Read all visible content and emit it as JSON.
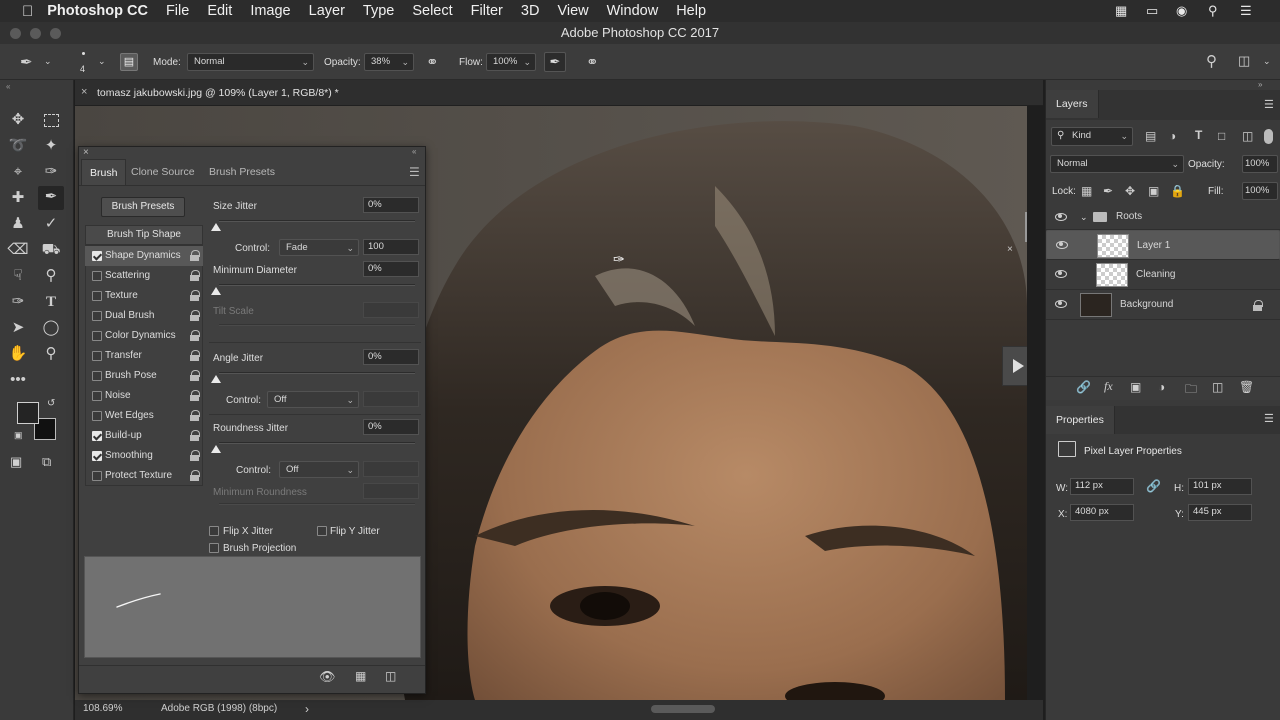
{
  "menubar": {
    "app": "Photoshop CC",
    "items": [
      "File",
      "Edit",
      "Image",
      "Layer",
      "Type",
      "Select",
      "Filter",
      "3D",
      "View",
      "Window",
      "Help"
    ]
  },
  "window": {
    "title": "Adobe Photoshop CC 2017"
  },
  "options": {
    "brush_size": "4",
    "mode_label": "Mode:",
    "mode_value": "Normal",
    "opacity_label": "Opacity:",
    "opacity_value": "38%",
    "flow_label": "Flow:",
    "flow_value": "100%"
  },
  "document": {
    "tab_title": "tomasz jakubowski.jpg @ 109% (Layer 1, RGB/8*) *"
  },
  "status": {
    "zoom": "108.69%",
    "profile": "Adobe RGB (1998) (8bpc)"
  },
  "brush_panel": {
    "tabs": [
      "Brush",
      "Clone Source",
      "Brush Presets"
    ],
    "presets_button": "Brush Presets",
    "tip_shape": "Brush Tip Shape",
    "options": [
      {
        "label": "Shape Dynamics",
        "checked": true
      },
      {
        "label": "Scattering",
        "checked": false
      },
      {
        "label": "Texture",
        "checked": false
      },
      {
        "label": "Dual Brush",
        "checked": false
      },
      {
        "label": "Color Dynamics",
        "checked": false
      },
      {
        "label": "Transfer",
        "checked": false
      },
      {
        "label": "Brush Pose",
        "checked": false
      },
      {
        "label": "Noise",
        "checked": false
      },
      {
        "label": "Wet Edges",
        "checked": false
      },
      {
        "label": "Build-up",
        "checked": true
      },
      {
        "label": "Smoothing",
        "checked": true
      },
      {
        "label": "Protect Texture",
        "checked": false
      }
    ],
    "size_jitter": {
      "label": "Size Jitter",
      "value": "0%"
    },
    "control1": {
      "label": "Control:",
      "value": "Fade",
      "amount": "100"
    },
    "min_diameter": {
      "label": "Minimum Diameter",
      "value": "0%"
    },
    "tilt_scale": {
      "label": "Tilt Scale"
    },
    "angle_jitter": {
      "label": "Angle Jitter",
      "value": "0%"
    },
    "control2": {
      "label": "Control:",
      "value": "Off"
    },
    "roundness_jitter": {
      "label": "Roundness Jitter",
      "value": "0%"
    },
    "control3": {
      "label": "Control:",
      "value": "Off"
    },
    "min_roundness": {
      "label": "Minimum Roundness"
    },
    "flip_x": "Flip X Jitter",
    "flip_y": "Flip Y Jitter",
    "brush_projection": "Brush Projection"
  },
  "layers": {
    "tab": "Layers",
    "filter_kind": "Kind",
    "blend": "Normal",
    "opacity_label": "Opacity:",
    "opacity_value": "100%",
    "lock_label": "Lock:",
    "fill_label": "Fill:",
    "fill_value": "100%",
    "items": [
      {
        "name": "Roots",
        "type": "group"
      },
      {
        "name": "Layer 1",
        "type": "pixel",
        "selected": true
      },
      {
        "name": "Cleaning",
        "type": "pixel"
      },
      {
        "name": "Background",
        "type": "background",
        "locked": true
      }
    ]
  },
  "properties": {
    "tab": "Properties",
    "title": "Pixel Layer Properties",
    "w_label": "W:",
    "w": "112 px",
    "h_label": "H:",
    "h": "101 px",
    "x_label": "X:",
    "x": "4080 px",
    "y_label": "Y:",
    "y": "445 px"
  }
}
